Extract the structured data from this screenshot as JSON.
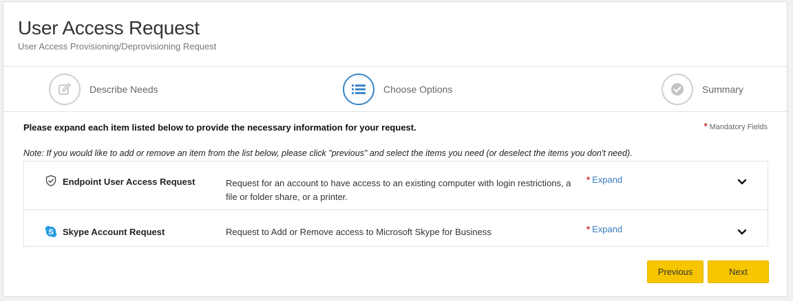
{
  "header": {
    "title": "User Access Request",
    "subtitle": "User Access Provisioning/Deprovisioning Request"
  },
  "steps": [
    {
      "label": "Describe Needs",
      "icon": "edit-icon",
      "state": "inactive"
    },
    {
      "label": "Choose Options",
      "icon": "list-icon",
      "state": "active"
    },
    {
      "label": "Summary",
      "icon": "check-icon",
      "state": "inactive"
    }
  ],
  "instructions": "Please expand each item listed below to provide the necessary information for your request.",
  "mandatory": {
    "star": "*",
    "label": "Mandatory Fields"
  },
  "note": "Note: If you would like to add or remove an item from the list below, please click \"previous\" and select the items you need (or deselect the items you don't need).",
  "items": [
    {
      "name": "Endpoint User Access Request",
      "icon": "shield-check-icon",
      "description": "Request for an account to have access to an existing computer with login restrictions, a file or folder share, or a printer.",
      "star": "*",
      "expand": "Expand"
    },
    {
      "name": "Skype Account Request",
      "icon": "skype-icon",
      "description": "Request to Add or Remove access to Microsoft Skype for Business",
      "star": "*",
      "expand": "Expand"
    }
  ],
  "buttons": {
    "previous": "Previous",
    "next": "Next"
  },
  "colors": {
    "accent": "#3a86c8",
    "button": "#f7c600",
    "required": "#c9302c",
    "link": "#3a7bbf"
  }
}
